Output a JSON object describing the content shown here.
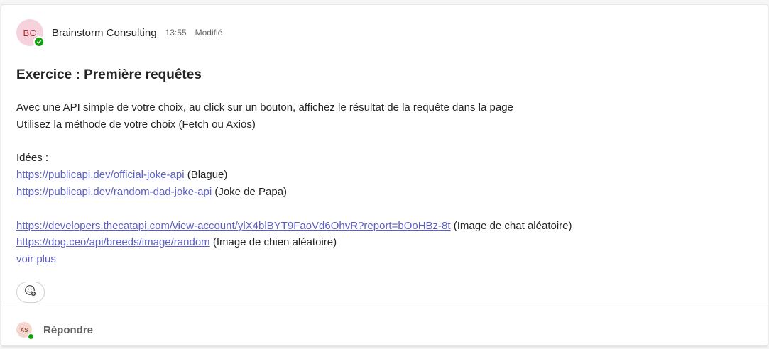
{
  "post": {
    "author_initials": "BC",
    "author_name": "Brainstorm Consulting",
    "time": "13:55",
    "edited_label": "Modifié",
    "subject": "Exercice : Première requêtes",
    "lines": {
      "l1": "Avec une API simple de votre choix, au click sur un bouton, affichez le résultat de la requête dans la page",
      "l2": "Utilisez la méthode de votre choix (Fetch ou Axios)",
      "l3": "Idées :"
    },
    "links": [
      {
        "url": "https://publicapi.dev/official-joke-api",
        "note": " (Blague)"
      },
      {
        "url": "https://publicapi.dev/random-dad-joke-api",
        "note": " (Joke de Papa)"
      },
      {
        "url": "https://developers.thecatapi.com/view-account/ylX4blBYT9FaoVd6OhvR?report=bOoHBz-8t",
        "note": " (Image de chat aléatoire)"
      },
      {
        "url": "https://dog.ceo/api/breeds/image/random",
        "note": " (Image de chien aléatoire)"
      }
    ],
    "see_more_label": "voir plus",
    "presence_color": "#13a10e",
    "link_color": "#5b5fc7"
  },
  "reply": {
    "avatar_initials": "AS",
    "label": "Répondre"
  },
  "icons": {
    "reaction": "add-reaction-icon",
    "presence": "available-check-icon"
  }
}
